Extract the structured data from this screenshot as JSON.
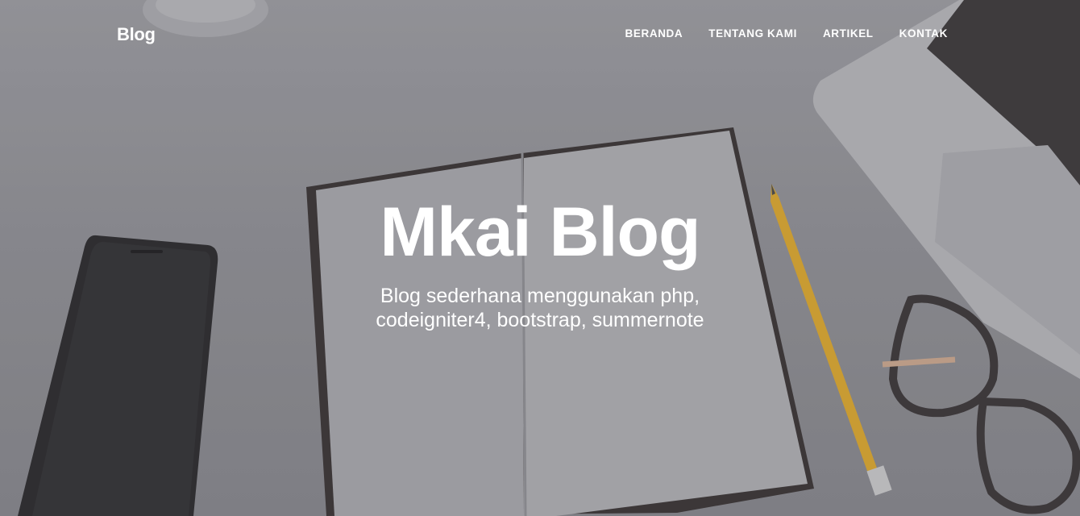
{
  "navbar": {
    "brand": "Blog",
    "links": [
      "BERANDA",
      "TENTANG KAMI",
      "ARTIKEL",
      "KONTAK"
    ]
  },
  "hero": {
    "title": "Mkai Blog",
    "subtitle": "Blog sederhana menggunakan php, codeigniter4, bootstrap, summernote"
  },
  "colors": {
    "text": "#ffffff",
    "background": "#8f8f94"
  }
}
